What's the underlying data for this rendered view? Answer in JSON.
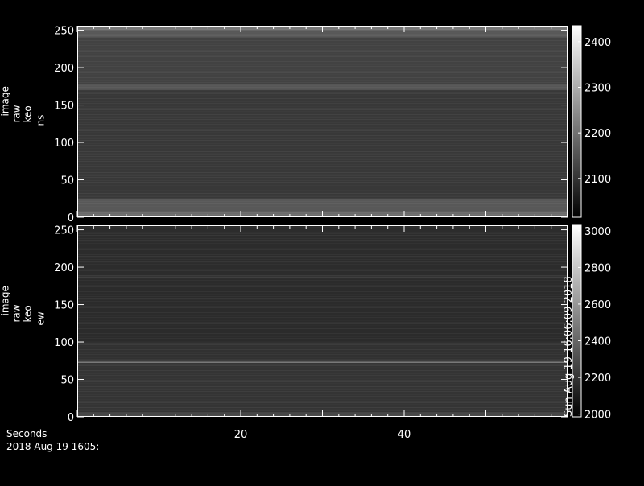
{
  "chart_data": [
    {
      "type": "heatmap",
      "ylabel_lines": [
        "image",
        "raw",
        "keo",
        "ns"
      ],
      "y_ticks": [
        0,
        50,
        100,
        150,
        200,
        250
      ],
      "ylim": [
        0,
        256
      ],
      "colorbar": {
        "ticks": [
          2100,
          2200,
          2300,
          2400
        ],
        "range": [
          2015,
          2435
        ]
      },
      "bands": [
        {
          "y": [
            0,
            8
          ],
          "value": 2330
        },
        {
          "y": [
            8,
            25
          ],
          "value": 2260
        },
        {
          "y": [
            25,
            170
          ],
          "value": 2130
        },
        {
          "y": [
            170,
            178
          ],
          "value": 2250
        },
        {
          "y": [
            178,
            240
          ],
          "value": 2170
        },
        {
          "y": [
            240,
            250
          ],
          "value": 2260
        },
        {
          "y": [
            250,
            256
          ],
          "value": 2380
        }
      ]
    },
    {
      "type": "heatmap",
      "ylabel_lines": [
        "image",
        "raw",
        "keo",
        "ew"
      ],
      "y_ticks": [
        0,
        50,
        100,
        150,
        200,
        250
      ],
      "ylim": [
        0,
        256
      ],
      "colorbar": {
        "ticks": [
          2000,
          2200,
          2400,
          2600,
          2800,
          3000
        ],
        "range": [
          1985,
          3030
        ]
      },
      "bands": [
        {
          "y": [
            0,
            6
          ],
          "value": 2420
        },
        {
          "y": [
            6,
            72
          ],
          "value": 2230
        },
        {
          "y": [
            72,
            74
          ],
          "value": 2900
        },
        {
          "y": [
            74,
            100
          ],
          "value": 2200
        },
        {
          "y": [
            100,
            185
          ],
          "value": 2150
        },
        {
          "y": [
            185,
            190
          ],
          "value": 2220
        },
        {
          "y": [
            190,
            256
          ],
          "value": 2160
        }
      ]
    }
  ],
  "x_axis": {
    "label": "Seconds",
    "ticks": [
      20,
      40
    ],
    "xlim": [
      0,
      60
    ]
  },
  "timestamp": "2018 Aug 19 1605:",
  "side_annotation": "Sun Aug 19 16:06:09 2018"
}
